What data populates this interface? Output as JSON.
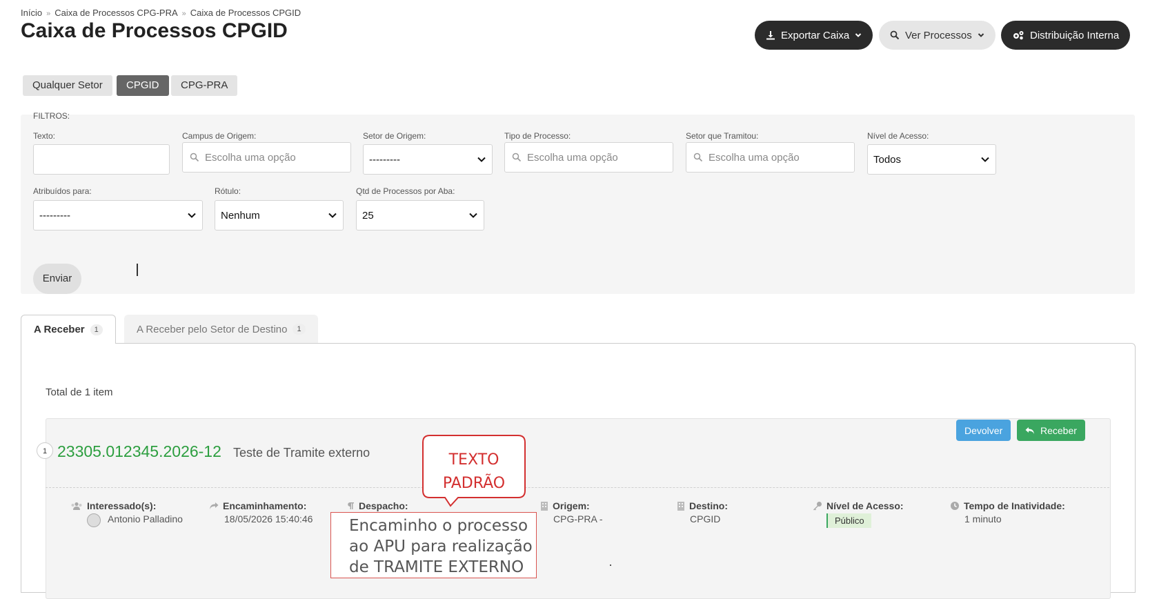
{
  "breadcrumb": [
    "Início",
    "Caixa de Processos CPG-PRA",
    "Caixa de Processos CPGID"
  ],
  "page_title": "Caixa de Processos CPGID",
  "actions": {
    "export": "Exportar Caixa",
    "view": "Ver Processos",
    "distribution": "Distribuição Interna"
  },
  "sector_tabs": [
    {
      "label": "Qualquer Setor",
      "active": false
    },
    {
      "label": "CPGID",
      "active": true
    },
    {
      "label": "CPG-PRA",
      "active": false
    }
  ],
  "filters": {
    "heading": "FILTROS:",
    "texto": {
      "label": "Texto:",
      "value": ""
    },
    "campus": {
      "label": "Campus de Origem:",
      "placeholder": "Escolha uma opção"
    },
    "setor_origem": {
      "label": "Setor de Origem:",
      "value": "---------"
    },
    "tipo_processo": {
      "label": "Tipo de Processo:",
      "placeholder": "Escolha uma opção"
    },
    "setor_tramitou": {
      "label": "Setor que Tramitou:",
      "placeholder": "Escolha uma opção"
    },
    "nivel_acesso": {
      "label": "Nível de Acesso:",
      "value": "Todos"
    },
    "atribuidos": {
      "label": "Atribuídos para:",
      "value": "---------"
    },
    "rotulo": {
      "label": "Rótulo:",
      "value": "Nenhum"
    },
    "qtd": {
      "label": "Qtd de Processos por Aba:",
      "value": "25"
    },
    "submit": "Enviar"
  },
  "tabs": [
    {
      "label": "A Receber",
      "count": "1",
      "active": true
    },
    {
      "label": "A Receber pelo Setor de Destino",
      "count": "1",
      "active": false
    }
  ],
  "total": "Total de 1 item",
  "process": {
    "index": "1",
    "number": "23305.012345.2026-12",
    "description": "Teste de Tramite externo",
    "buttons": {
      "devolver": "Devolver",
      "receber": "Receber"
    },
    "fields": {
      "interessados": {
        "label": "Interessado(s):",
        "value": "Antonio Palladino"
      },
      "encaminhamento": {
        "label": "Encaminhamento:",
        "value": "18/05/2026 15:40:46"
      },
      "despacho": {
        "label": "Despacho:"
      },
      "origem": {
        "label": "Origem:",
        "value": "CPG-PRA -"
      },
      "destino": {
        "label": "Destino:",
        "value": "CPGID"
      },
      "nivel_acesso": {
        "label": "Nível de Acesso:",
        "value": "Público"
      },
      "tempo_inatividade": {
        "label": "Tempo de Inatividade:",
        "value": "1 minuto"
      }
    }
  },
  "annotations": {
    "callout": [
      "TEXTO",
      "PADRÃO"
    ],
    "note": [
      "Encaminho o processo",
      "ao APU  para realização",
      "de TRAMITE EXTERNO"
    ]
  },
  "colors": {
    "process_number": "#2c9e3f",
    "devolver": "#4aa3df",
    "receber": "#3aa760",
    "callout": "#d32f2f",
    "dark_button": "#2b2b2b"
  },
  "icons": [
    "download-icon",
    "search-icon",
    "cogs-icon",
    "chevron-down-icon",
    "reply-icon",
    "users-icon",
    "share-icon",
    "paragraph-icon",
    "building-icon",
    "key-icon",
    "clock-icon"
  ]
}
